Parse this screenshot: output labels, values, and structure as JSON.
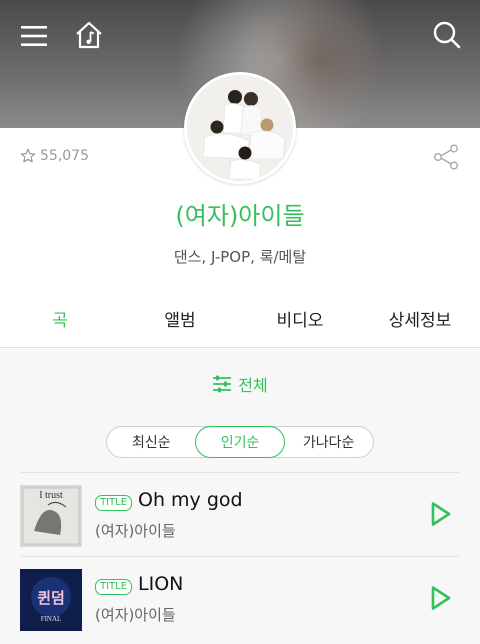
{
  "header": {
    "menu_icon": "hamburger-menu-icon",
    "home_icon": "music-home-icon",
    "search_icon": "search-icon"
  },
  "artist": {
    "likes": "55,075",
    "name": "(여자)아이들",
    "genres": "댄스, J-POP, 록/메탈"
  },
  "tabs": [
    {
      "label": "곡",
      "active": true
    },
    {
      "label": "앨범",
      "active": false
    },
    {
      "label": "비디오",
      "active": false
    },
    {
      "label": "상세정보",
      "active": false
    }
  ],
  "filter": {
    "label": "전체",
    "icon": "filter-sliders-icon"
  },
  "sort": [
    {
      "label": "최신순",
      "active": false
    },
    {
      "label": "인기순",
      "active": true
    },
    {
      "label": "가나다순",
      "active": false
    }
  ],
  "songs": [
    {
      "badge": "TITLE",
      "title": "Oh my god",
      "artist": "(여자)아이들",
      "album_art_text": "I trust"
    },
    {
      "badge": "TITLE",
      "title": "LION",
      "artist": "(여자)아이들",
      "album_art_text": "퀸덤",
      "album_art_subtext": "FINAL"
    }
  ],
  "colors": {
    "accent": "#34c05a"
  }
}
